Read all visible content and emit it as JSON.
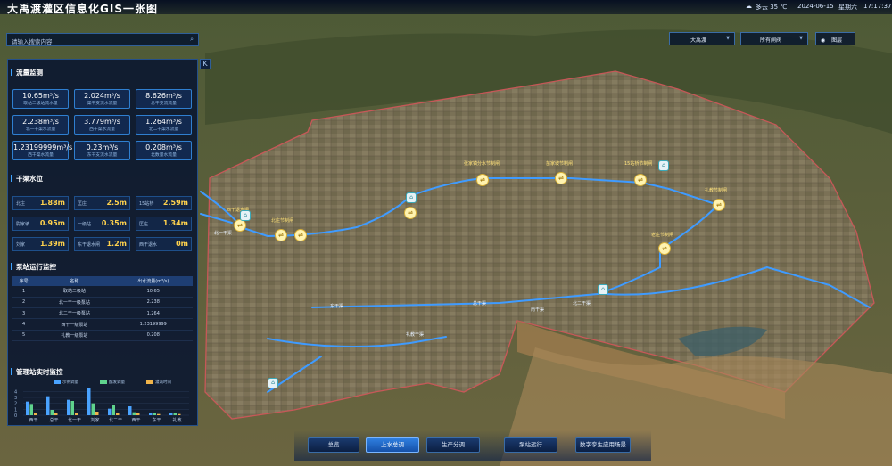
{
  "header": {
    "title": "大禹渡灌区信息化GIS一张图",
    "weather": "多云 35 ℃",
    "date": "2024-06-15",
    "weekday": "星期六",
    "time": "17:17:37"
  },
  "search": {
    "placeholder": "请输入搜索内容"
  },
  "controls": {
    "dropdown1": "大禹渡",
    "dropdown2": "所有闸阀",
    "layer_label": "图层"
  },
  "flow": {
    "title": "流量监测",
    "cards": [
      {
        "value": "10.65m³/s",
        "label": "取站二级站流水量"
      },
      {
        "value": "2.024m³/s",
        "label": "渠干支流水流量"
      },
      {
        "value": "8.626m³/s",
        "label": "总干支流流量"
      },
      {
        "value": "2.238m³/s",
        "label": "北一干渠水流量"
      },
      {
        "value": "3.779m³/s",
        "label": "西干渠水流量"
      },
      {
        "value": "1.264m³/s",
        "label": "北二干渠水流量"
      },
      {
        "value": "1.23199999m³/s",
        "label": "西干渠水流量"
      },
      {
        "value": "0.23m³/s",
        "label": "东干支流水流量"
      },
      {
        "value": "0.208m³/s",
        "label": "北数量水流量"
      }
    ]
  },
  "water_level": {
    "title": "干渠水位",
    "cells": [
      {
        "name": "北庄",
        "value": "1.88m"
      },
      {
        "name": "匡庄",
        "value": "2.5m"
      },
      {
        "name": "15站桥",
        "value": "2.59m"
      },
      {
        "name": "尉家坡",
        "value": "0.95m"
      },
      {
        "name": "一级站",
        "value": "0.35m"
      },
      {
        "name": "匡庄",
        "value": "1.34m"
      },
      {
        "name": "刘家",
        "value": "1.39m"
      },
      {
        "name": "东干退水闸",
        "value": "1.2m"
      },
      {
        "name": "西干退水",
        "value": "0m"
      }
    ]
  },
  "pump_stations": {
    "title": "泵站运行监控",
    "headers": [
      "序号",
      "名称",
      "出水流量(m³/s)"
    ],
    "rows": [
      [
        "1",
        "取站二级站",
        "10.65"
      ],
      [
        "2",
        "北一干一级泵站",
        "2.238"
      ],
      [
        "3",
        "北二干一级泵站",
        "1.264"
      ],
      [
        "4",
        "西干一级泵站",
        "1.23199999"
      ],
      [
        "5",
        "礼教一级泵站",
        "0.208"
      ]
    ]
  },
  "mgmt": {
    "title": "管理站实时监控",
    "legend": [
      "示例调量",
      "配发调量",
      "灌溉时间"
    ],
    "legend_colors": [
      "#4aa3ff",
      "#5fd38d",
      "#f0b44a"
    ],
    "chart_data": {
      "type": "bar",
      "categories": [
        "西干",
        "总干",
        "北一干",
        "刘家",
        "北二干",
        "西干",
        "东干",
        "礼教"
      ],
      "series": [
        {
          "name": "示例调量",
          "values": [
            2.3,
            3.2,
            2.6,
            4.5,
            1.1,
            1.5,
            0.4,
            0.3
          ]
        },
        {
          "name": "配发调量",
          "values": [
            1.9,
            0.9,
            2.4,
            2.0,
            1.7,
            0.5,
            0.3,
            0.3
          ]
        },
        {
          "name": "灌溉时间",
          "values": [
            0.3,
            0.3,
            0.4,
            0.6,
            0.3,
            0.4,
            0.2,
            0.2
          ]
        }
      ],
      "yticks": [
        "4",
        "3",
        "2",
        "1",
        "0"
      ],
      "ylim": [
        0,
        4.5
      ]
    }
  },
  "map": {
    "gates": [
      {
        "label": "张家镇分水节制闸"
      },
      {
        "label": "苗家坡节制闸"
      },
      {
        "label": "15站桥节制闸"
      },
      {
        "label": "礼教节制闸"
      },
      {
        "label": "西干退水闸"
      },
      {
        "label": "北庄节制闸"
      },
      {
        "label": "老庄节制闸"
      }
    ],
    "canals": [
      "北一干渠",
      "东干渠",
      "礼教干渠",
      "总干渠",
      "北二干渠",
      "南干渠"
    ]
  },
  "nav": {
    "items": [
      "总览",
      "上水总调",
      "生产分调",
      "泵站运行",
      "数字孪生应用场景"
    ],
    "active": 1
  }
}
